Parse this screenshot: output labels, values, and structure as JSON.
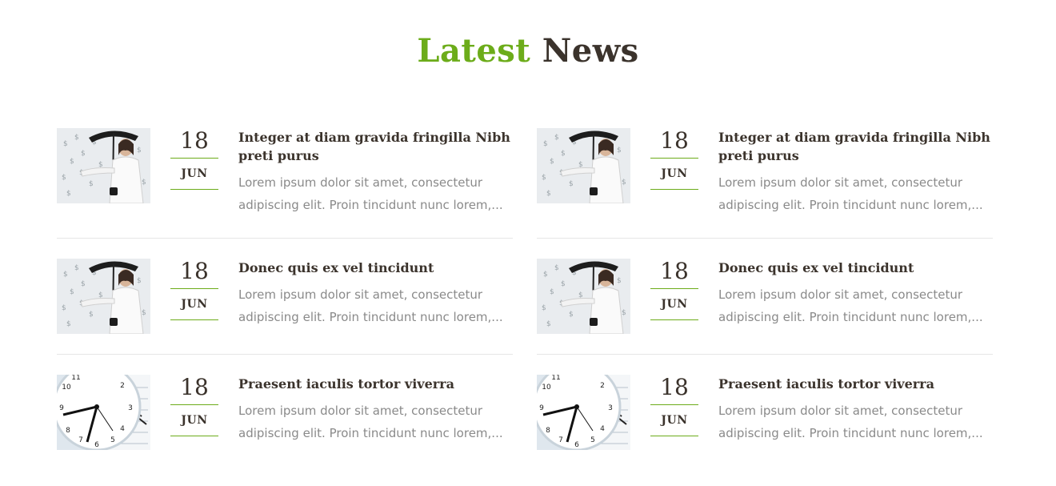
{
  "section": {
    "title_accent": "Latest",
    "title_rest": "News"
  },
  "news": {
    "left": [
      {
        "image": "woman-umbrella-money",
        "day": "18",
        "month": "JUN",
        "title": "Integer at diam gravida fringilla Nibh preti purus",
        "excerpt": "Lorem ipsum dolor sit amet, consectetur adipiscing elit. Proin tincidunt nunc lorem,..."
      },
      {
        "image": "woman-umbrella-money",
        "day": "18",
        "month": "JUN",
        "title": "Donec quis ex vel tincidunt",
        "excerpt": "Lorem ipsum dolor sit amet, consectetur adipiscing elit. Proin tincidunt nunc lorem,..."
      },
      {
        "image": "clock-calendar",
        "day": "18",
        "month": "JUN",
        "title": "Praesent iaculis tortor viverra",
        "excerpt": "Lorem ipsum dolor sit amet, consectetur adipiscing elit. Proin tincidunt nunc lorem,..."
      }
    ],
    "right": [
      {
        "image": "woman-umbrella-money",
        "day": "18",
        "month": "JUN",
        "title": "Integer at diam gravida fringilla Nibh preti purus",
        "excerpt": "Lorem ipsum dolor sit amet, consectetur adipiscing elit. Proin tincidunt nunc lorem,..."
      },
      {
        "image": "woman-umbrella-money",
        "day": "18",
        "month": "JUN",
        "title": "Donec quis ex vel tincidunt",
        "excerpt": "Lorem ipsum dolor sit amet, consectetur adipiscing elit. Proin tincidunt nunc lorem,..."
      },
      {
        "image": "clock-calendar",
        "day": "18",
        "month": "JUN",
        "title": "Praesent iaculis tortor viverra",
        "excerpt": "Lorem ipsum dolor sit amet, consectetur adipiscing elit. Proin tincidunt nunc lorem,..."
      }
    ]
  },
  "colors": {
    "accent": "#6cac1a",
    "heading": "#3b332c",
    "body_text": "#8a8a8a",
    "divider": "#e6e6e6"
  }
}
